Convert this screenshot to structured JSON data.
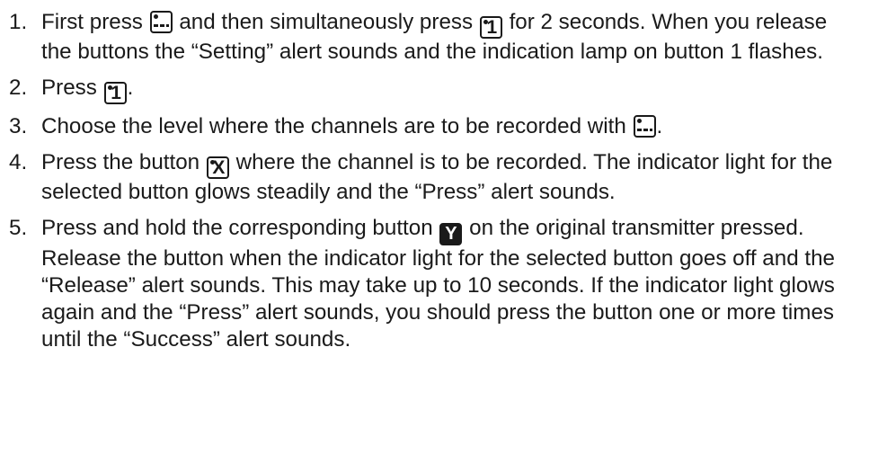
{
  "steps": [
    {
      "number": "1.",
      "t1": "First press",
      "t2": "and then simultaneously press",
      "icon_key_1": "1",
      "t3": "for 2 seconds. When you release the buttons the “Setting” alert sounds and the indication lamp on button 1 flashes."
    },
    {
      "number": "2.",
      "t1": "Press",
      "icon_key_1": "1",
      "t2": "."
    },
    {
      "number": "3.",
      "t1": "Choose the level where the channels are to be recorded with",
      "t2": "."
    },
    {
      "number": "4.",
      "t1": "Press the button",
      "icon_key_x": "X",
      "t2": "where the channel is to be recorded. The indicator light for the selected button glows steadily and the “Press” alert sounds."
    },
    {
      "number": "5.",
      "t1": "Press and hold the corresponding button",
      "icon_key_y": "Y",
      "t2": "on the original transmitter pressed. Release the button when the indicator light for the selected button goes off and the “Release” alert sounds. This may take up to 10 seconds. If the indicator light glows again and the “Press” alert sounds, you should press the button one or more times until the “Success” alert sounds."
    }
  ],
  "icons": {
    "level_button": "level-select-button-icon",
    "numbered_button": "channel-button-icon",
    "transmitter_button": "transmitter-button-icon"
  }
}
